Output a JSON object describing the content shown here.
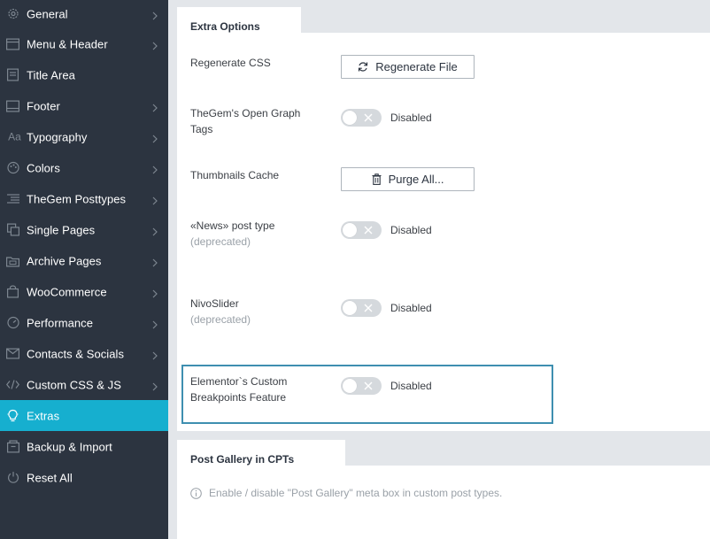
{
  "sidebar": {
    "items": [
      {
        "label": "General",
        "icon": "gear-icon",
        "active": false
      },
      {
        "label": "Menu & Header",
        "icon": "menu-header-icon",
        "active": false
      },
      {
        "label": "Title Area",
        "icon": "title-area-icon",
        "active": false
      },
      {
        "label": "Footer",
        "icon": "footer-icon",
        "active": false
      },
      {
        "label": "Typography",
        "icon": "typography-icon",
        "active": false
      },
      {
        "label": "Colors",
        "icon": "palette-icon",
        "active": false
      },
      {
        "label": "TheGem Posttypes",
        "icon": "list-icon",
        "active": false
      },
      {
        "label": "Single Pages",
        "icon": "pages-icon",
        "active": false
      },
      {
        "label": "Archive Pages",
        "icon": "archive-icon",
        "active": false
      },
      {
        "label": "WooCommerce",
        "icon": "shopping-bag-icon",
        "active": false
      },
      {
        "label": "Performance",
        "icon": "speedometer-icon",
        "active": false
      },
      {
        "label": "Contacts & Socials",
        "icon": "mail-icon",
        "active": false
      },
      {
        "label": "Custom CSS & JS",
        "icon": "code-icon",
        "active": false
      },
      {
        "label": "Extras",
        "icon": "lightbulb-icon",
        "active": true
      },
      {
        "label": "Backup & Import",
        "icon": "backup-icon",
        "active": false
      },
      {
        "label": "Reset All",
        "icon": "power-icon",
        "active": false
      }
    ]
  },
  "extra_options": {
    "title": "Extra Options",
    "regenerate_css": {
      "label": "Regenerate CSS",
      "button": "Regenerate File"
    },
    "open_graph": {
      "label_line1": "TheGem's Open Graph",
      "label_line2": "Tags",
      "state": "Disabled"
    },
    "thumbnails_cache": {
      "label": "Thumbnails Cache",
      "button": "Purge All..."
    },
    "news_post_type": {
      "label": "«News» post type",
      "sub": "(deprecated)",
      "state": "Disabled"
    },
    "nivoslider": {
      "label": "NivoSlider",
      "sub": "(deprecated)",
      "state": "Disabled"
    },
    "elementor_breakpoints": {
      "label_line1": "Elementor`s Custom",
      "label_line2": "Breakpoints Feature",
      "state": "Disabled"
    }
  },
  "post_gallery": {
    "title": "Post Gallery in CPTs",
    "info": "Enable / disable \"Post Gallery\" meta box in custom post types."
  },
  "colors": {
    "sidebar_bg": "#2c3440",
    "active_bg": "#16afcf",
    "highlight_border": "#3e8fb0"
  }
}
